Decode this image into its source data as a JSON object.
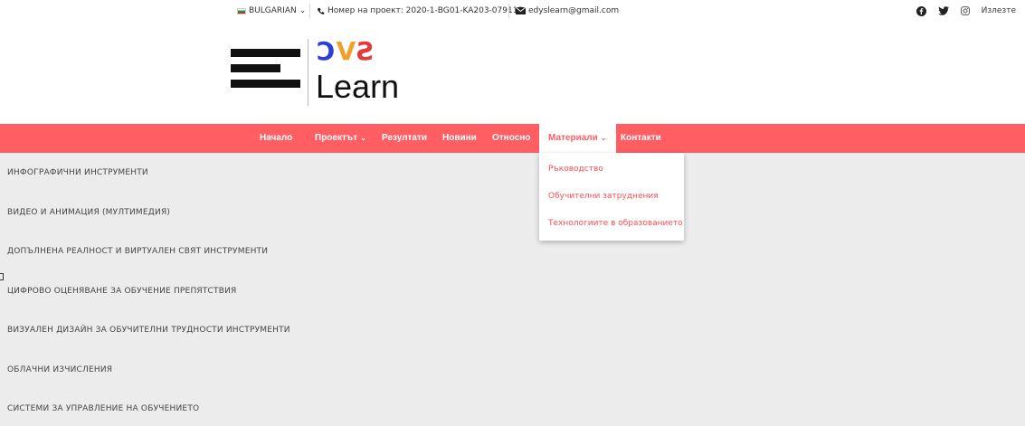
{
  "topbar": {
    "language": "BULGARIAN",
    "language_caret": "⌄",
    "phone_icon": "phone-icon",
    "project_number": "Номер на проект: 2020-1-BG01-KA203-079118",
    "mail_icon": "mail-icon",
    "email": "edyslearn@gmail.com",
    "socials": [
      "facebook-icon",
      "twitter-icon",
      "instagram-icon"
    ],
    "login_label": "Излезте"
  },
  "logo": {
    "mark_part1": "Ↄ",
    "mark_part2": "V",
    "mark_part3": "Ƨ",
    "text": "Learn"
  },
  "nav": {
    "items": [
      {
        "label": "Начало"
      },
      {
        "label": "Проектът",
        "caret": "⌄"
      },
      {
        "label": "Резултати"
      },
      {
        "label": "Новини"
      },
      {
        "label": "Относно"
      },
      {
        "label": "Материали",
        "caret": "⌄"
      },
      {
        "label": "Контакти"
      }
    ],
    "active_index": 5
  },
  "dropdown": {
    "items": [
      "Ръководство",
      "Обучителни затруднения",
      "Технологиите в образованието"
    ]
  },
  "categories": [
    "ИНФОГРАФИЧНИ ИНСТРУМЕНТИ",
    "ВИДЕО И АНИМАЦИЯ (МУЛТИМЕДИЯ)",
    "ДОПЪЛНЕНА РЕАЛНОСТ И ВИРТУАЛЕН СВЯТ ИНСТРУМЕНТИ",
    "ЦИФРОВО ОЦЕНЯВАНЕ ЗА ОБУЧЕНИЕ ПРЕПЯТСТВИЯ",
    "ВИЗУАЛЕН ДИЗАЙН ЗА ОБУЧИТЕЛНИ ТРУДНОСТИ ИНСТРУМЕНТИ",
    "ОБЛАЧНИ ИЗЧИСЛЕНИЯ",
    "СИСТЕМИ ЗА УПРАВЛЕНИЕ НА ОБУЧЕНИЕТО"
  ],
  "colors": {
    "nav_background": "#ff5e63",
    "dropdown_text": "#ff4d55",
    "content_background": "#ececec"
  }
}
